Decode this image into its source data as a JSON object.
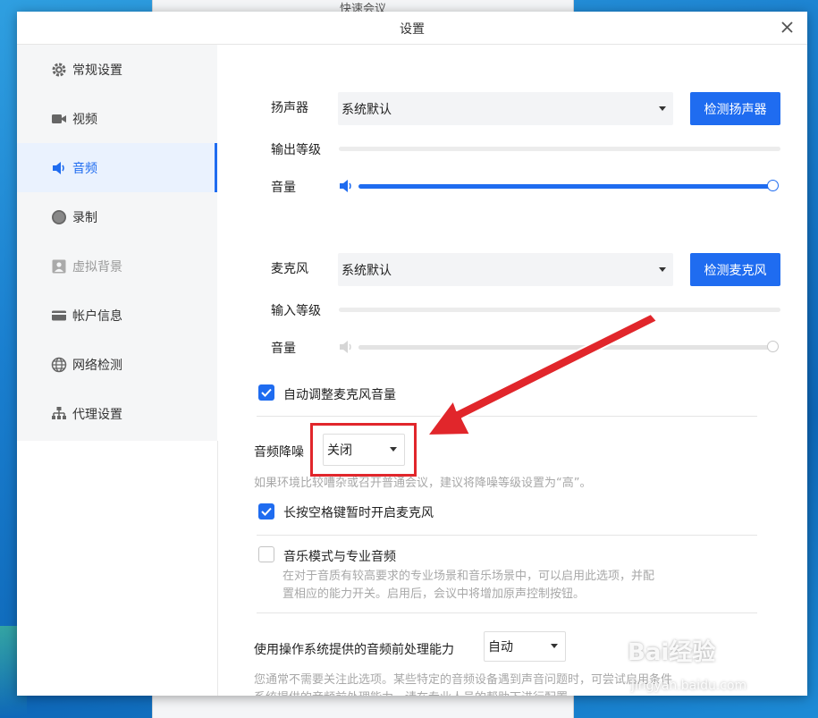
{
  "background_window": {
    "title": "快速会议"
  },
  "dialog": {
    "title": "设置",
    "close_label": "×"
  },
  "sidebar": {
    "items": [
      {
        "label": "常规设置",
        "icon": "gear-icon"
      },
      {
        "label": "视频",
        "icon": "camera-icon"
      },
      {
        "label": "音频",
        "icon": "speaker-icon",
        "active": true
      },
      {
        "label": "录制",
        "icon": "record-icon"
      },
      {
        "label": "虚拟背景",
        "icon": "portrait-icon",
        "disabled": true
      },
      {
        "label": "帐户信息",
        "icon": "card-icon"
      },
      {
        "label": "网络检测",
        "icon": "globe-icon"
      },
      {
        "label": "代理设置",
        "icon": "network-tree-icon"
      }
    ]
  },
  "speaker": {
    "label": "扬声器",
    "device": "系统默认",
    "test_button": "检测扬声器",
    "output_level_label": "输出等级",
    "output_level": 0,
    "volume_label": "音量",
    "volume": 100
  },
  "microphone": {
    "label": "麦克风",
    "device": "系统默认",
    "test_button": "检测麦克风",
    "input_level_label": "输入等级",
    "input_level": 0,
    "volume_label": "音量",
    "volume": 100,
    "volume_disabled": true
  },
  "auto_adjust": {
    "label": "自动调整麦克风音量",
    "checked": true
  },
  "noise_reduction": {
    "label": "音频降噪",
    "value": "关闭",
    "hint": "如果环境比较嘈杂或召开普通会议，建议将降噪等级设置为“高”。"
  },
  "push_to_talk": {
    "label": "长按空格键暂时开启麦克风",
    "checked": true
  },
  "music_mode": {
    "label": "音乐模式与专业音频",
    "checked": false,
    "desc_line1": "在对于音质有较高要求的专业场景和音乐场景中，可以启用此选项，并配",
    "desc_line2": "置相应的能力开关。启用后，会议中将增加原声控制按钮。"
  },
  "os_processing": {
    "label": "使用操作系统提供的音频前处理能力",
    "value": "自动",
    "desc_line1": "您通常不需要关注此选项。某些特定的音频设备遇到声音问题时，可尝试启用条件",
    "desc_line2": "系统提供的音频前处理能力，请在专业人员的帮助下进行配置。"
  },
  "watermark": {
    "brand": "Bai经验",
    "url": "jingyan.baidu.com"
  },
  "colors": {
    "accent": "#1f6cf0",
    "highlight": "#e1262b",
    "arrow": "#e1262b"
  }
}
